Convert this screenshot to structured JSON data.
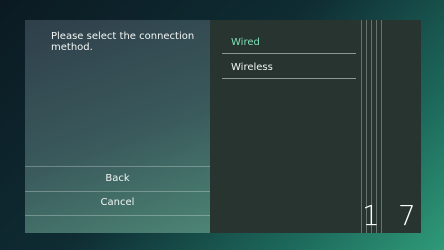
{
  "dialog": {
    "prompt": "Please select the connection method."
  },
  "left_menu": {
    "back_label": "Back",
    "cancel_label": "Cancel"
  },
  "options": [
    {
      "label": "Wired",
      "selected": true
    },
    {
      "label": "Wireless",
      "selected": false
    }
  ],
  "pager": {
    "current": "1",
    "total": "7"
  },
  "colors": {
    "accent": "#7fe0b7",
    "panel_right": "#27342f"
  }
}
